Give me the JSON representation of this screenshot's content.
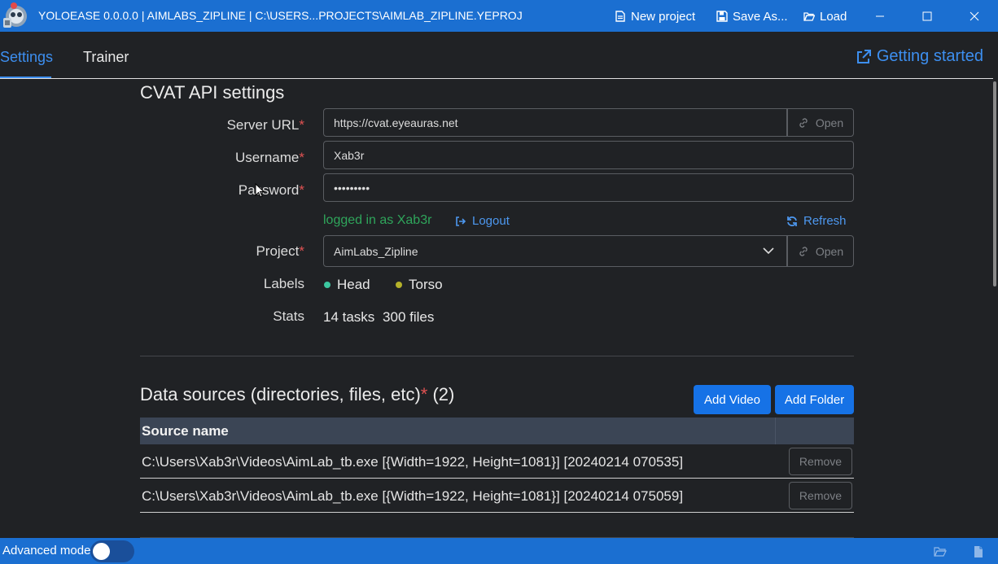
{
  "window": {
    "title": "YOLOEASE 0.0.0.0 | AIMLABS_ZIPLINE | C:\\USERS...PROJECTS\\AIMLAB_ZIPLINE.YEPROJ",
    "toolbar": {
      "new_project": "New project",
      "save_as": "Save As...",
      "load": "Load"
    }
  },
  "tabs": [
    {
      "label": "Settings",
      "active": true
    },
    {
      "label": "Trainer",
      "active": false
    }
  ],
  "getting_started": "Getting started",
  "cvat": {
    "title": "CVAT API settings",
    "server_url": {
      "label": "Server URL",
      "value": "https://cvat.eyeauras.net",
      "open": "Open"
    },
    "username": {
      "label": "Username",
      "value": "Xab3r"
    },
    "password": {
      "label": "Password",
      "value": "•••••••••"
    },
    "status": "logged in as Xab3r",
    "logout": "Logout",
    "refresh": "Refresh",
    "project": {
      "label": "Project",
      "value": "AimLabs_Zipline",
      "open": "Open"
    },
    "labels": {
      "label": "Labels",
      "items": [
        {
          "name": "Head",
          "color": "#3cc7a0"
        },
        {
          "name": "Torso",
          "color": "#b5b22a"
        }
      ]
    },
    "stats": {
      "label": "Stats",
      "tasks": "14 tasks",
      "files": "300 files"
    }
  },
  "data_sources": {
    "title": "Data sources (directories, files, etc)",
    "count": "(2)",
    "add_video": "Add Video",
    "add_folder": "Add Folder",
    "column_header": "Source name",
    "rows": [
      {
        "source": "C:\\Users\\Xab3r\\Videos\\AimLab_tb.exe [{Width=1922, Height=1081}] [20240214 070535]",
        "remove": "Remove"
      },
      {
        "source": "C:\\Users\\Xab3r\\Videos\\AimLab_tb.exe [{Width=1922, Height=1081}] [20240214 075059]",
        "remove": "Remove"
      }
    ]
  },
  "statusbar": {
    "advanced_mode": "Advanced mode",
    "advanced_mode_on": false
  },
  "colors": {
    "accent": "#1b6fd1",
    "link": "#3d8ff0",
    "success": "#2fa55b",
    "required": "#e05252"
  }
}
